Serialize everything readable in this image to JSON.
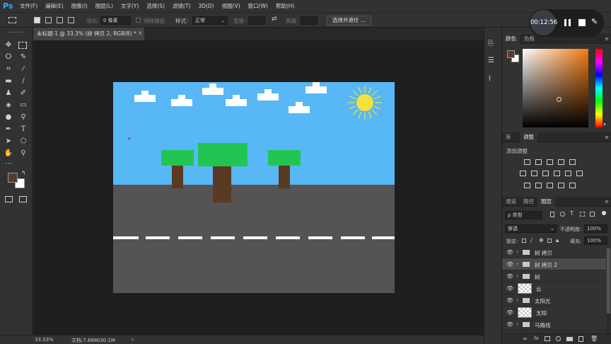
{
  "app": {
    "logo": "Ps"
  },
  "menubar": {
    "items": [
      "文件(F)",
      "编辑(E)",
      "图像(I)",
      "图层(L)",
      "文字(Y)",
      "选择(S)",
      "滤镜(T)",
      "3D(D)",
      "视图(V)",
      "窗口(W)",
      "帮助(H)"
    ]
  },
  "options": {
    "feather_label": "羽化:",
    "feather_value": "0 像素",
    "antialias_label": "消除锯齿",
    "style_label": "样式:",
    "style_value": "正常",
    "width_label": "宽度:",
    "height_label": "高度:",
    "select_mask_button": "选择并遮住 ..."
  },
  "recorder": {
    "time": "00:12:56"
  },
  "document": {
    "tab_title": "未标题-1 @ 33.3% (树 拷贝 2, RGB/8) *"
  },
  "status": {
    "zoom": "33.33%",
    "doc_info": "文档:7.66M/30.1M",
    "arrow": "›"
  },
  "color_panel": {
    "tabs": [
      "颜色",
      "色板"
    ],
    "active": 0,
    "fg_color": "#5a3a2a",
    "bg_color": "#ffffff"
  },
  "adjust_panel": {
    "tabs": [
      "库",
      "调整"
    ],
    "active": 1,
    "title": "添加调整"
  },
  "layers_panel": {
    "tabs": [
      "通道",
      "路径",
      "图层"
    ],
    "active": 2,
    "filter_label": "ρ 类型",
    "blend_mode": "穿透",
    "opacity_label": "不透明度:",
    "opacity_value": "100%",
    "lock_label": "锁定:",
    "fill_label": "填充:",
    "fill_value": "100%",
    "layers": [
      {
        "name": "树 拷贝",
        "type": "group",
        "selected": false
      },
      {
        "name": "树 拷贝 2",
        "type": "group",
        "selected": true
      },
      {
        "name": "树",
        "type": "group",
        "selected": false
      },
      {
        "name": "云",
        "type": "layer",
        "selected": false
      },
      {
        "name": "太阳光",
        "type": "group",
        "selected": false
      },
      {
        "name": "太阳",
        "type": "layer",
        "selected": false
      },
      {
        "name": "马路线",
        "type": "group",
        "selected": false
      }
    ]
  },
  "canvas_colors": {
    "sky": "#57b8f5",
    "road": "#555354",
    "tree_crown": "#23c552",
    "trunk": "#5a3a22",
    "sun": "#f4e23a"
  }
}
